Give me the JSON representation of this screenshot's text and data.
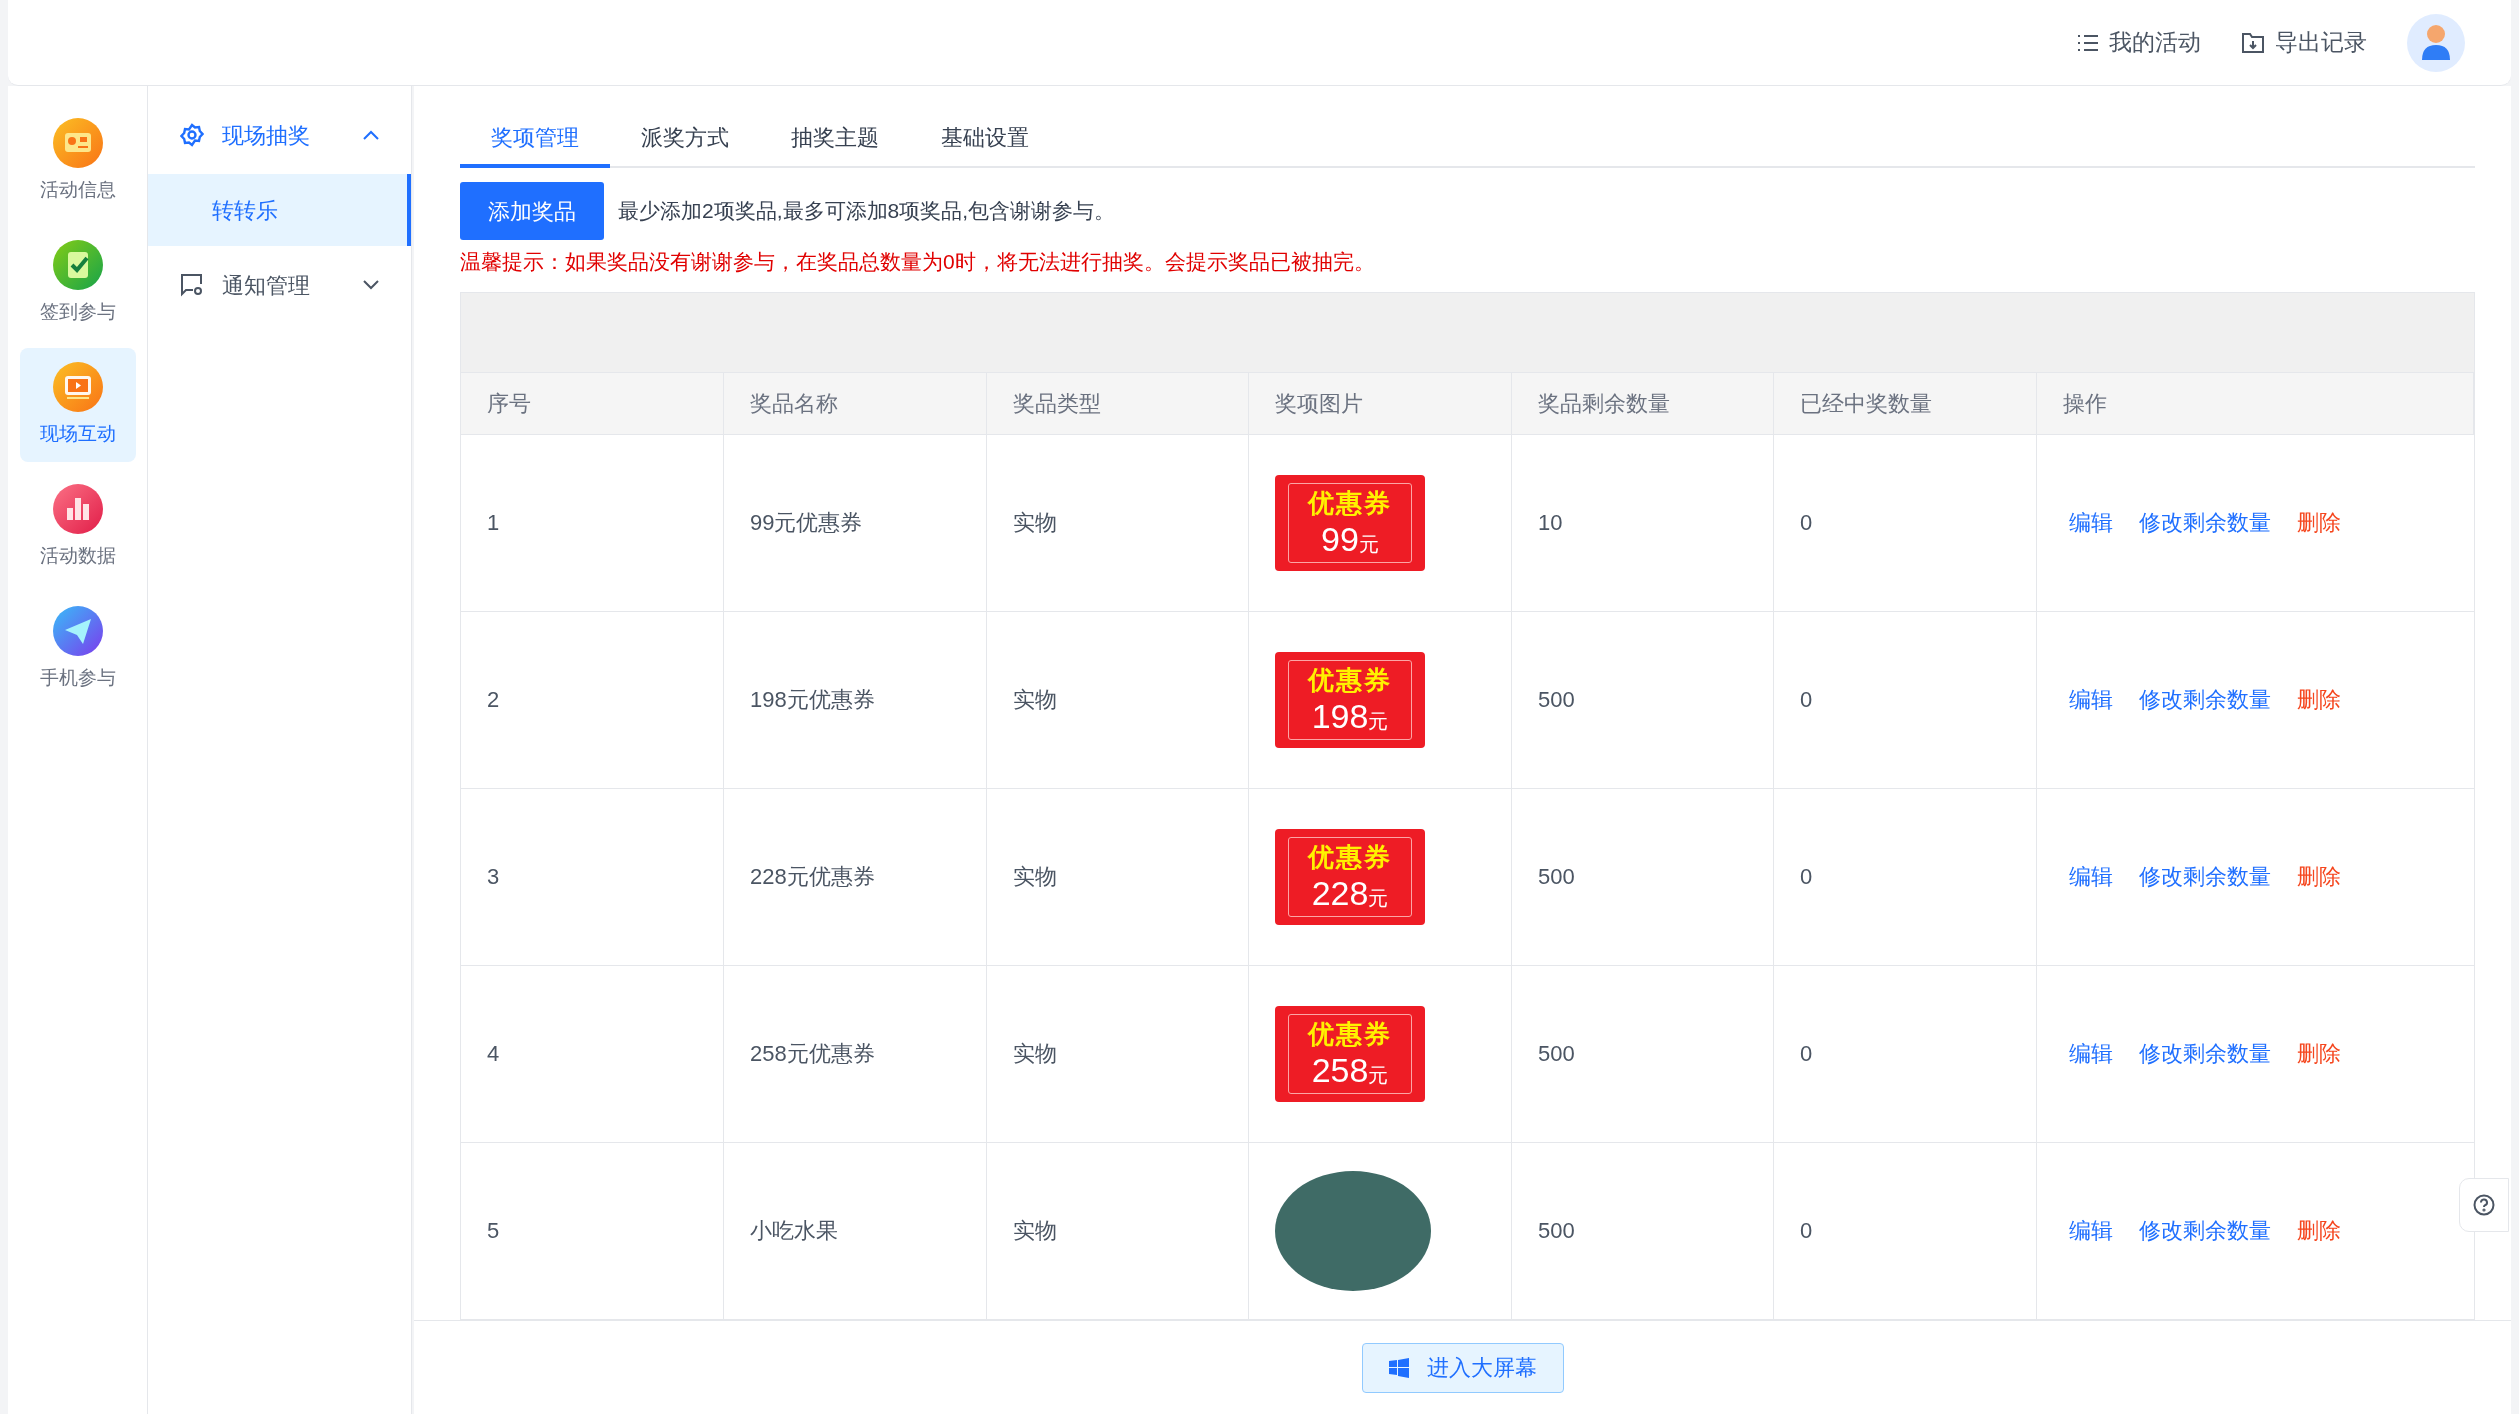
{
  "top_bar": {
    "links": [
      {
        "kind": "list",
        "label": "我的活动"
      },
      {
        "kind": "export",
        "label": "导出记录"
      }
    ]
  },
  "icon_rail": [
    {
      "kind": "info",
      "label": "活动信息",
      "selected": false
    },
    {
      "kind": "signin",
      "label": "签到参与",
      "selected": false
    },
    {
      "kind": "live",
      "label": "现场互动",
      "selected": true
    },
    {
      "kind": "data",
      "label": "活动数据",
      "selected": false
    },
    {
      "kind": "mobile",
      "label": "手机参与",
      "selected": false
    }
  ],
  "menu": [
    {
      "kind": "gear",
      "label": "现场抽奖",
      "expanded": true,
      "selected": true,
      "children": [
        {
          "label": "转转乐",
          "selected": true
        }
      ]
    },
    {
      "kind": "notice",
      "label": "通知管理",
      "expanded": false,
      "selected": false
    }
  ],
  "tabs": [
    {
      "label": "奖项管理",
      "selected": true
    },
    {
      "label": "派奖方式",
      "selected": false
    },
    {
      "label": "抽奖主题",
      "selected": false
    },
    {
      "label": "基础设置",
      "selected": false
    }
  ],
  "add_button": "添加奖品",
  "note": "最少添加2项奖品,最多可添加8项奖品,包含谢谢参与。",
  "warning": "温馨提示：如果奖品没有谢谢参与，在奖品总数量为0时，将无法进行抽奖。会提示奖品已被抽完。",
  "table": {
    "columns": [
      "序号",
      "奖品名称",
      "奖品类型",
      "奖项图片",
      "奖品剩余数量",
      "已经中奖数量",
      "操作"
    ],
    "rows": [
      {
        "index": "1",
        "name": "99元优惠券",
        "type": "实物",
        "image": {
          "kind": "coupon",
          "title": "优惠券",
          "amount": "99",
          "unit": "元"
        },
        "remaining": "10",
        "won": "0",
        "actions": [
          "编辑",
          "修改剩余数量",
          "删除"
        ]
      },
      {
        "index": "2",
        "name": "198元优惠券",
        "type": "实物",
        "image": {
          "kind": "coupon",
          "title": "优惠券",
          "amount": "198",
          "unit": "元"
        },
        "remaining": "500",
        "won": "0",
        "actions": [
          "编辑",
          "修改剩余数量",
          "删除"
        ]
      },
      {
        "index": "3",
        "name": "228元优惠券",
        "type": "实物",
        "image": {
          "kind": "coupon",
          "title": "优惠券",
          "amount": "228",
          "unit": "元"
        },
        "remaining": "500",
        "won": "0",
        "actions": [
          "编辑",
          "修改剩余数量",
          "删除"
        ]
      },
      {
        "index": "4",
        "name": "258元优惠券",
        "type": "实物",
        "image": {
          "kind": "coupon",
          "title": "优惠券",
          "amount": "258",
          "unit": "元"
        },
        "remaining": "500",
        "won": "0",
        "actions": [
          "编辑",
          "修改剩余数量",
          "删除"
        ]
      },
      {
        "index": "5",
        "name": "小吃水果",
        "type": "实物",
        "image": {
          "kind": "photo"
        },
        "remaining": "500",
        "won": "0",
        "actions": [
          "编辑",
          "修改剩余数量",
          "删除"
        ]
      }
    ]
  },
  "footer_button": "进入大屏幕"
}
